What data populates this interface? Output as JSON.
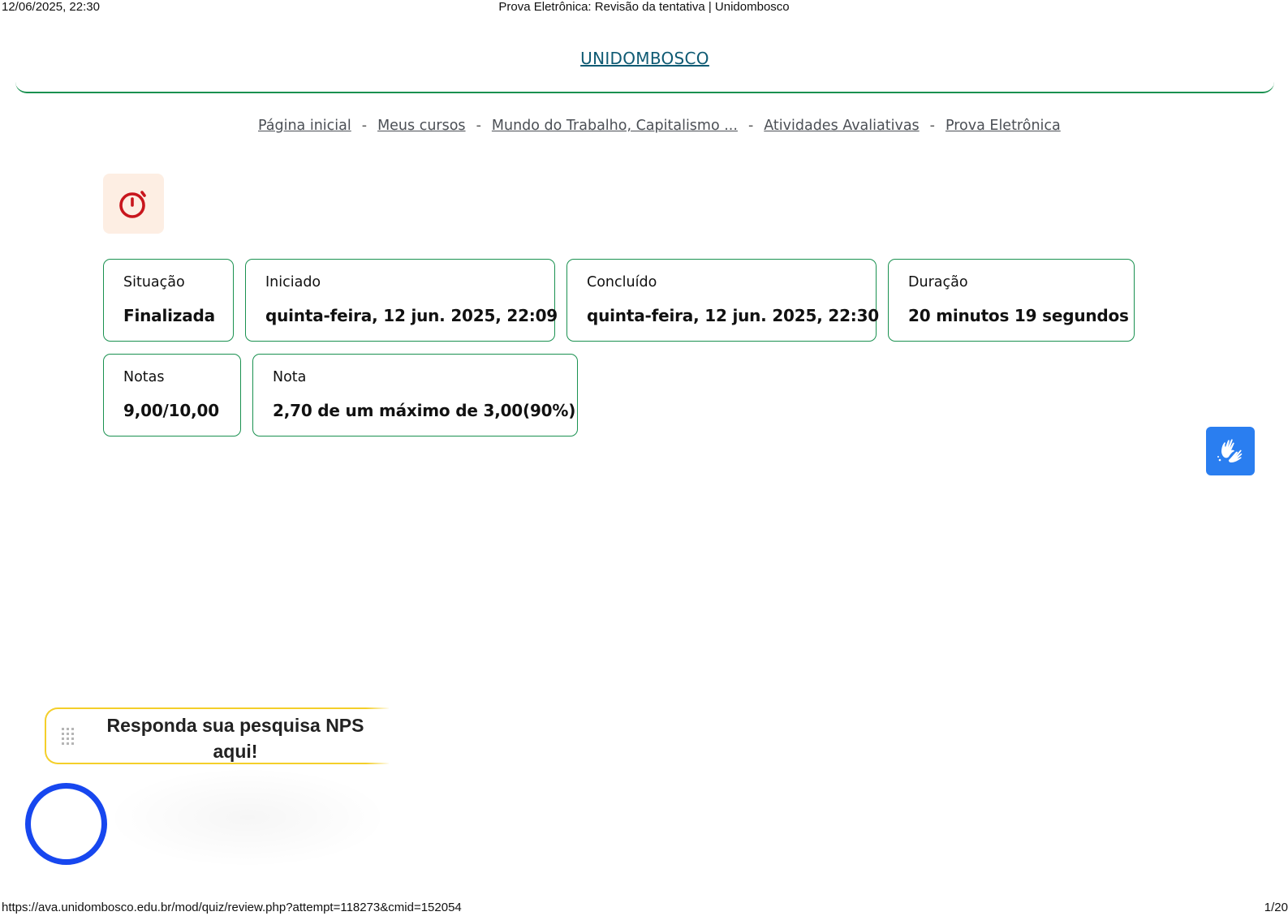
{
  "print": {
    "datetime": "12/06/2025, 22:30",
    "page_title": "Prova Eletrônica: Revisão da tentativa | Unidombosco",
    "url": "https://ava.unidombosco.edu.br/mod/quiz/review.php?attempt=118273&cmid=152054",
    "page_number": "1/20"
  },
  "header": {
    "brand": "UNIDOMBOSCO"
  },
  "breadcrumb": {
    "items": [
      "Página inicial",
      "Meus cursos",
      "Mundo do Trabalho, Capitalismo ...",
      "Atividades Avaliativas",
      "Prova Eletrônica"
    ],
    "separator": "-"
  },
  "summary": {
    "status": {
      "label": "Situação",
      "value": "Finalizada"
    },
    "started": {
      "label": "Iniciado",
      "value": "quinta-feira, 12 jun. 2025, 22:09"
    },
    "completed": {
      "label": "Concluído",
      "value": "quinta-feira, 12 jun. 2025, 22:30"
    },
    "duration": {
      "label": "Duração",
      "value": "20 minutos 19 segundos"
    },
    "marks": {
      "label": "Notas",
      "value": "9,00/10,00"
    },
    "grade": {
      "label": "Nota",
      "value": "2,70 de um máximo de 3,00(90%)"
    }
  },
  "nps": {
    "text": "Responda sua pesquisa NPS aqui!"
  },
  "icons": {
    "timer": "stopwatch-icon",
    "libras": "sign-language-hands-icon",
    "drag": "drag-handle-icon",
    "chat": "chat-launcher-ring"
  },
  "colors": {
    "accent_green": "#1a9150",
    "brand_link": "#0e5a73",
    "timer_red": "#c8161d",
    "timer_bg": "#fdeee3",
    "libras_blue": "#2a7ef0",
    "nps_border": "#f4cf2a",
    "chat_blue": "#1747ef"
  }
}
